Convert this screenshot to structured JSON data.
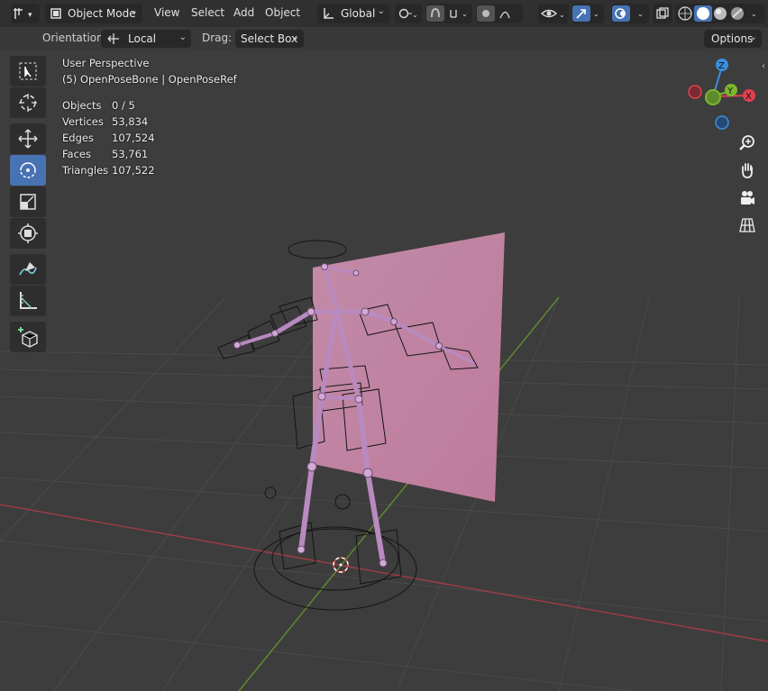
{
  "header": {
    "mode": "Object Mode",
    "menus": [
      "View",
      "Select",
      "Add",
      "Object"
    ],
    "transform_orientation": "Global"
  },
  "tool_header": {
    "orientation_label": "Orientation:",
    "orientation_value": "Local",
    "drag_label": "Drag:",
    "drag_value": "Select Box",
    "options_label": "Options"
  },
  "overlay": {
    "view_name": "User Perspective",
    "active_object": "(5) OpenPoseBone | OpenPoseRef",
    "stats": [
      {
        "label": "Objects",
        "value": "0 / 5"
      },
      {
        "label": "Vertices",
        "value": "53,834"
      },
      {
        "label": "Edges",
        "value": "107,524"
      },
      {
        "label": "Faces",
        "value": "53,761"
      },
      {
        "label": "Triangles",
        "value": "107,522"
      }
    ]
  },
  "gizmo": {
    "z": "Z",
    "y": "Y",
    "x": "X"
  },
  "toolbar": {
    "items": [
      "select-box-icon",
      "cursor-icon",
      "move-icon",
      "rotate-icon",
      "scale-icon",
      "transform-icon",
      "annotate-icon",
      "measure-icon",
      "add-cube-icon"
    ],
    "active": "rotate-icon"
  },
  "colors": {
    "accent": "#4772b3",
    "x_axis": "#e0404f",
    "y_axis": "#7bb82d",
    "z_axis": "#3a8fe0",
    "bone": "#b98ac0",
    "ref_plane": "#c98ca8"
  }
}
